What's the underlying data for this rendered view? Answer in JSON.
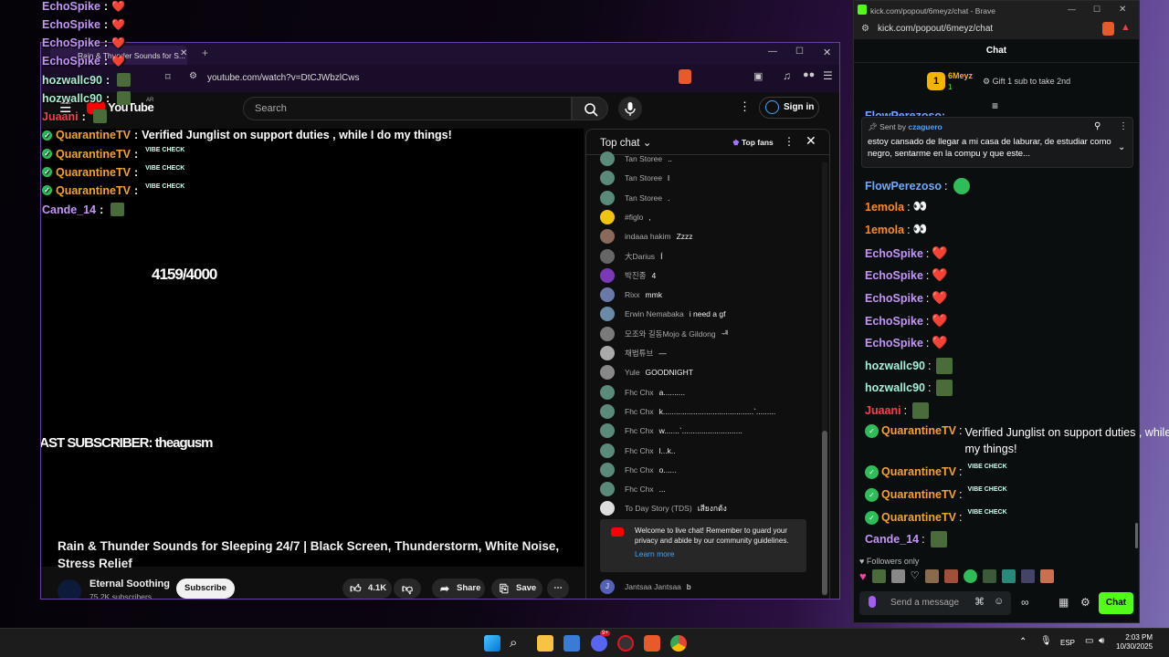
{
  "overlay": {
    "rows": [
      {
        "name": "EchoSpike",
        "color": "#c395f6",
        "msg": "❤️"
      },
      {
        "name": "EchoSpike",
        "color": "#c395f6",
        "msg": "❤️"
      },
      {
        "name": "EchoSpike",
        "color": "#c395f6",
        "msg": "❤️"
      },
      {
        "name": "EchoSpike",
        "color": "#c395f6",
        "msg": "❤️"
      },
      {
        "name": "hozwallc90",
        "color": "#a3f0d7",
        "msg": ""
      },
      {
        "name": "hozwallc90",
        "color": "#a3f0d7",
        "msg": ""
      },
      {
        "name": "Juaani",
        "color": "#ff3b4b",
        "msg": ""
      },
      {
        "name": "QuarantineTV",
        "color": "#f4a22d",
        "msg": "Verified Junglist on support duties , while I do my things!"
      },
      {
        "name": "QuarantineTV",
        "color": "#f4a22d",
        "msg": ""
      },
      {
        "name": "QuarantineTV",
        "color": "#f4a22d",
        "msg": ""
      },
      {
        "name": "QuarantineTV",
        "color": "#f4a22d",
        "msg": ""
      },
      {
        "name": "Cande_14",
        "color": "#c395f6",
        "msg": ""
      }
    ],
    "counter": "4159/4000",
    "last_subscriber": "LAST SUBSCRIBER: theagusm"
  },
  "yt_window": {
    "tab_title": "Rain & Thunder Sounds for S...",
    "url": "youtube.com/watch?v=DtCJWbzlCws",
    "logo_text": "YouTube",
    "logo_region": "AR",
    "search_placeholder": "Search",
    "sign_in": "Sign in",
    "video_title": "Rain & Thunder Sounds for Sleeping 24/7 | Black Screen, Thunderstorm, White Noise, Stress Relief",
    "channel": "Eternal Soothing",
    "subscribers": "75.2K subscribers",
    "subscribe": "Subscribe",
    "likes": "4.1K",
    "share": "Share",
    "save": "Save",
    "chat": {
      "title": "Top chat",
      "fans": "Top fans",
      "messages": [
        {
          "author": "Tan Storee",
          "text": ".."
        },
        {
          "author": "Tan Storee",
          "text": "l"
        },
        {
          "author": "Tan Storee",
          "text": "."
        },
        {
          "author": "#figlo",
          "text": ","
        },
        {
          "author": "indaaa hakim",
          "text": "Zzzz"
        },
        {
          "author": "大Darius",
          "text": "Í"
        },
        {
          "author": "박진종",
          "text": "4"
        },
        {
          "author": "Rixx",
          "text": "mmk"
        },
        {
          "author": "Erwin Nemabaka",
          "text": "i need a gf"
        },
        {
          "author": "모조와 길동Mojo & Gildong",
          "text": "ᆌ"
        },
        {
          "author": "채법튜브",
          "text": "—"
        },
        {
          "author": "Yule",
          "text": "GOODNIGHT"
        },
        {
          "author": "Fhc Chx",
          "text": "a.........."
        },
        {
          "author": "Fhc Chx",
          "text": "k..........................................`........."
        },
        {
          "author": "Fhc Chx",
          "text": "w.......`............................"
        },
        {
          "author": "Fhc Chx",
          "text": "l...k.."
        },
        {
          "author": "Fhc Chx",
          "text": "o......"
        },
        {
          "author": "Fhc Chx",
          "text": "..."
        },
        {
          "author": "To Day Story (TDS)",
          "text": "เสียงกต้ง"
        }
      ],
      "welcome": "Welcome to live chat! Remember to guard your privacy and abide by our community guidelines.",
      "learn_more": "Learn more",
      "last_author": "Jantsaa Jantsaa",
      "last_text": "b"
    }
  },
  "kick_window": {
    "title": "kick.com/popout/6meyz/chat - Brave",
    "url": "kick.com/popout/6meyz/chat",
    "chat_title": "Chat",
    "leader_name": "6Meyz",
    "leader_count": "1",
    "gift_text": "Gift 1 sub to take 2nd",
    "pinned_by_label": "Sent by",
    "pinned_by": "czaguero",
    "pinned_text": "estoy cansado de llegar a mi casa de laburar, de estudiar como negro, sentarme en la compu y que este...",
    "partial_top": "FlowPerezoso:",
    "rows": [
      {
        "name": "FlowPerezoso",
        "color": "#6ea9ff",
        "msg": ""
      },
      {
        "name": "1emola",
        "color": "#ff8a1e",
        "msg": "👀"
      },
      {
        "name": "1emola",
        "color": "#ff8a1e",
        "msg": "👀"
      },
      {
        "name": "EchoSpike",
        "color": "#c395f6",
        "msg": "❤️"
      },
      {
        "name": "EchoSpike",
        "color": "#c395f6",
        "msg": "❤️"
      },
      {
        "name": "EchoSpike",
        "color": "#c395f6",
        "msg": "❤️"
      },
      {
        "name": "EchoSpike",
        "color": "#c395f6",
        "msg": "❤️"
      },
      {
        "name": "EchoSpike",
        "color": "#c395f6",
        "msg": "❤️"
      },
      {
        "name": "hozwallc90",
        "color": "#a3f0d7",
        "msg": ""
      },
      {
        "name": "hozwallc90",
        "color": "#a3f0d7",
        "msg": ""
      },
      {
        "name": "Juaani",
        "color": "#ff3b4b",
        "msg": ""
      },
      {
        "name": "QuarantineTV",
        "color": "#f4a22d",
        "msg": "Verified Junglist on support duties , while I do my things!"
      },
      {
        "name": "QuarantineTV",
        "color": "#f4a22d",
        "msg": ""
      },
      {
        "name": "QuarantineTV",
        "color": "#f4a22d",
        "msg": ""
      },
      {
        "name": "QuarantineTV",
        "color": "#f4a22d",
        "msg": ""
      },
      {
        "name": "Cande_14",
        "color": "#c395f6",
        "msg": ""
      }
    ],
    "followers_only": "Followers only",
    "input_placeholder": "Send a message",
    "chat_button": "Chat"
  },
  "taskbar": {
    "lang": "ESP",
    "time": "2:03 PM",
    "date": "10/30/2025",
    "badge": "9+"
  }
}
